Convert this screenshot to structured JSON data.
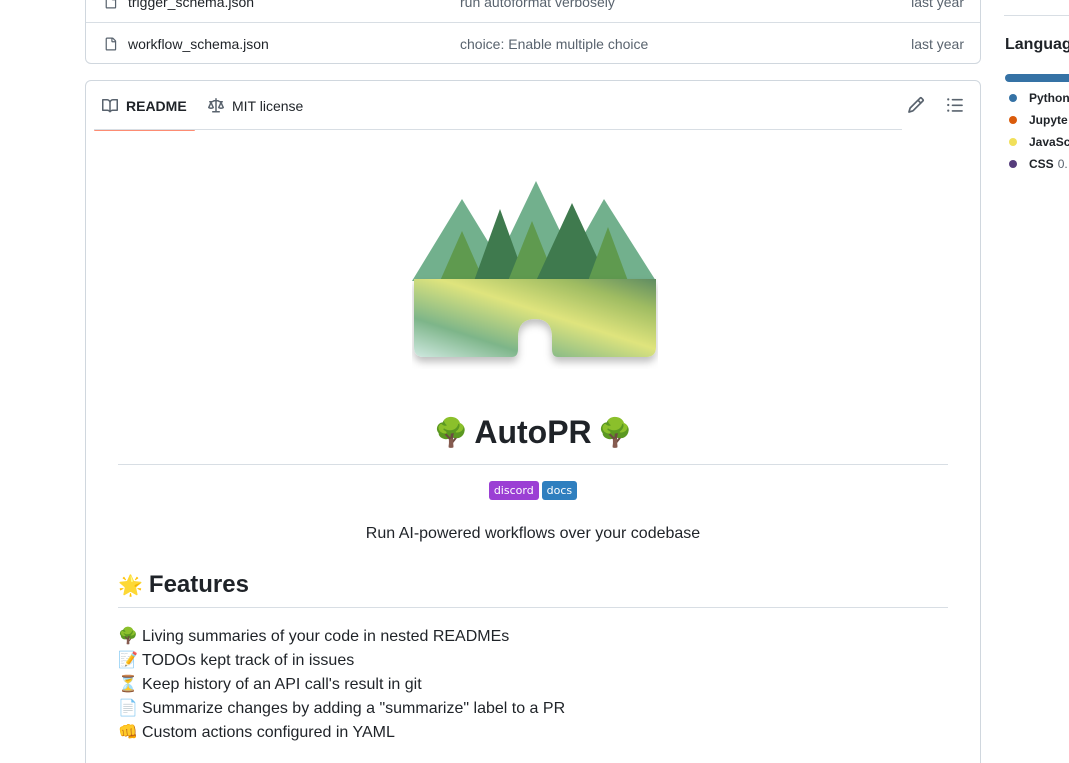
{
  "files": [
    {
      "name": "trigger_schema.json",
      "message": "run autoformat verbosely",
      "date": "last year"
    },
    {
      "name": "workflow_schema.json",
      "message": "choice: Enable multiple choice",
      "date": "last year"
    }
  ],
  "readme": {
    "tabs": [
      {
        "label": "README",
        "icon": "book-icon",
        "active": true
      },
      {
        "label": "MIT license",
        "icon": "law-icon",
        "active": false
      }
    ],
    "actions": [
      "pencil-icon",
      "list-unordered-icon"
    ],
    "title": "AutoPR",
    "title_emoji": "🌳",
    "badges": [
      {
        "label": "discord",
        "color": "#9b3fd4"
      },
      {
        "label": "docs",
        "color": "#2f7fbf"
      }
    ],
    "tagline": "Run AI-powered workflows over your codebase",
    "features_heading": "Features",
    "features_emoji": "🌟",
    "features": [
      {
        "emoji": "🌳",
        "text": "Living summaries of your code in nested READMEs"
      },
      {
        "emoji": "📝",
        "text": "TODOs kept track of in issues"
      },
      {
        "emoji": "⏳",
        "text": "Keep history of an API call's result in git"
      },
      {
        "emoji": "📄",
        "text": "Summarize changes by adding a \"summarize\" label to a PR"
      },
      {
        "emoji": "👊",
        "text": "Custom actions configured in YAML"
      }
    ]
  },
  "sidebar": {
    "languages_title": "Languag",
    "languages": [
      {
        "name": "Python",
        "pct": "",
        "color": "#3572A5"
      },
      {
        "name": "Jupyte",
        "pct": "",
        "color": "#DA5B0B"
      },
      {
        "name": "JavaSc",
        "pct": "",
        "color": "#f1e05a"
      },
      {
        "name": "CSS",
        "pct": "0.",
        "color": "#563d7c"
      }
    ]
  }
}
